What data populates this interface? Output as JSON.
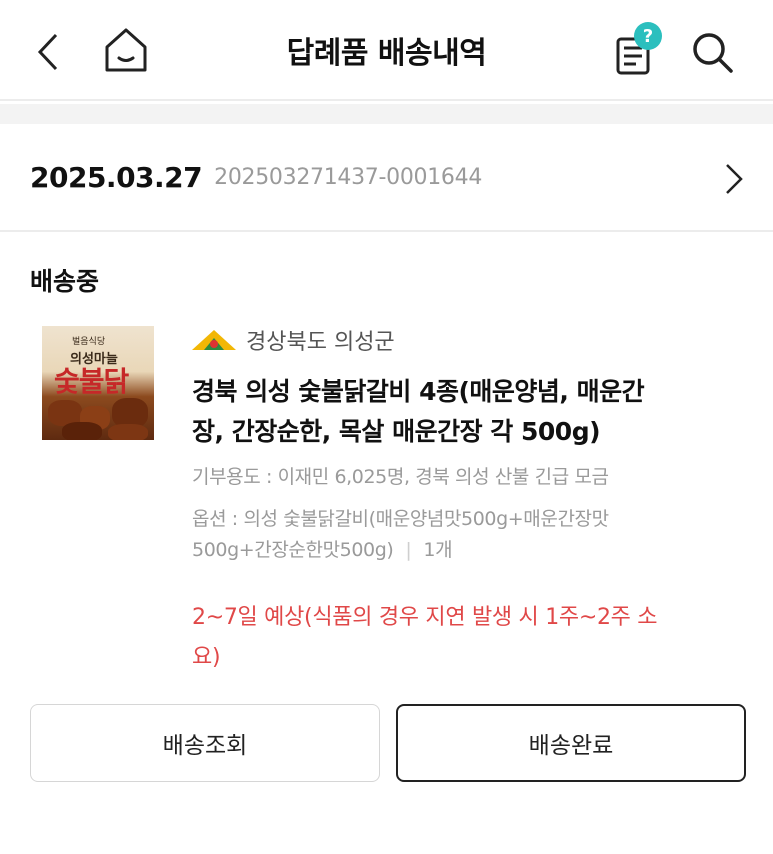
{
  "header": {
    "title": "답례품 배송내역",
    "notice_badge": "?",
    "icons": {
      "back": "chevron-left-icon",
      "home": "home-icon",
      "notice": "notice-list-icon",
      "search": "search-icon"
    },
    "accent": "#2bbfbe"
  },
  "order": {
    "date": "2025.03.27",
    "number": "202503271437-0001644"
  },
  "shipment": {
    "status": "배송중",
    "seller": "경상북도 의성군",
    "product_title": "경북 의성 숯불닭갈비 4종(매운양념, 매운간장, 간장순한, 목살 매운간장 각 500g)",
    "thumbnail": {
      "line1": "벌음식당",
      "line2": "의성마늘",
      "line3": "숯불닭"
    },
    "donation_use": "기부용도 : 이재민 6,025명, 경북 의성 산불 긴급 모금",
    "option_text": "옵션 : 의성 숯불닭갈비(매운양념맛500g+매운간장맛500g+간장순한맛500g)",
    "option_separator": "|",
    "quantity": "1개",
    "eta": "2~7일 예상(식품의 경우 지연 발생 시 1주~2주 소요)",
    "eta_color": "#e04848"
  },
  "buttons": {
    "track": "배송조회",
    "complete": "배송완료"
  }
}
